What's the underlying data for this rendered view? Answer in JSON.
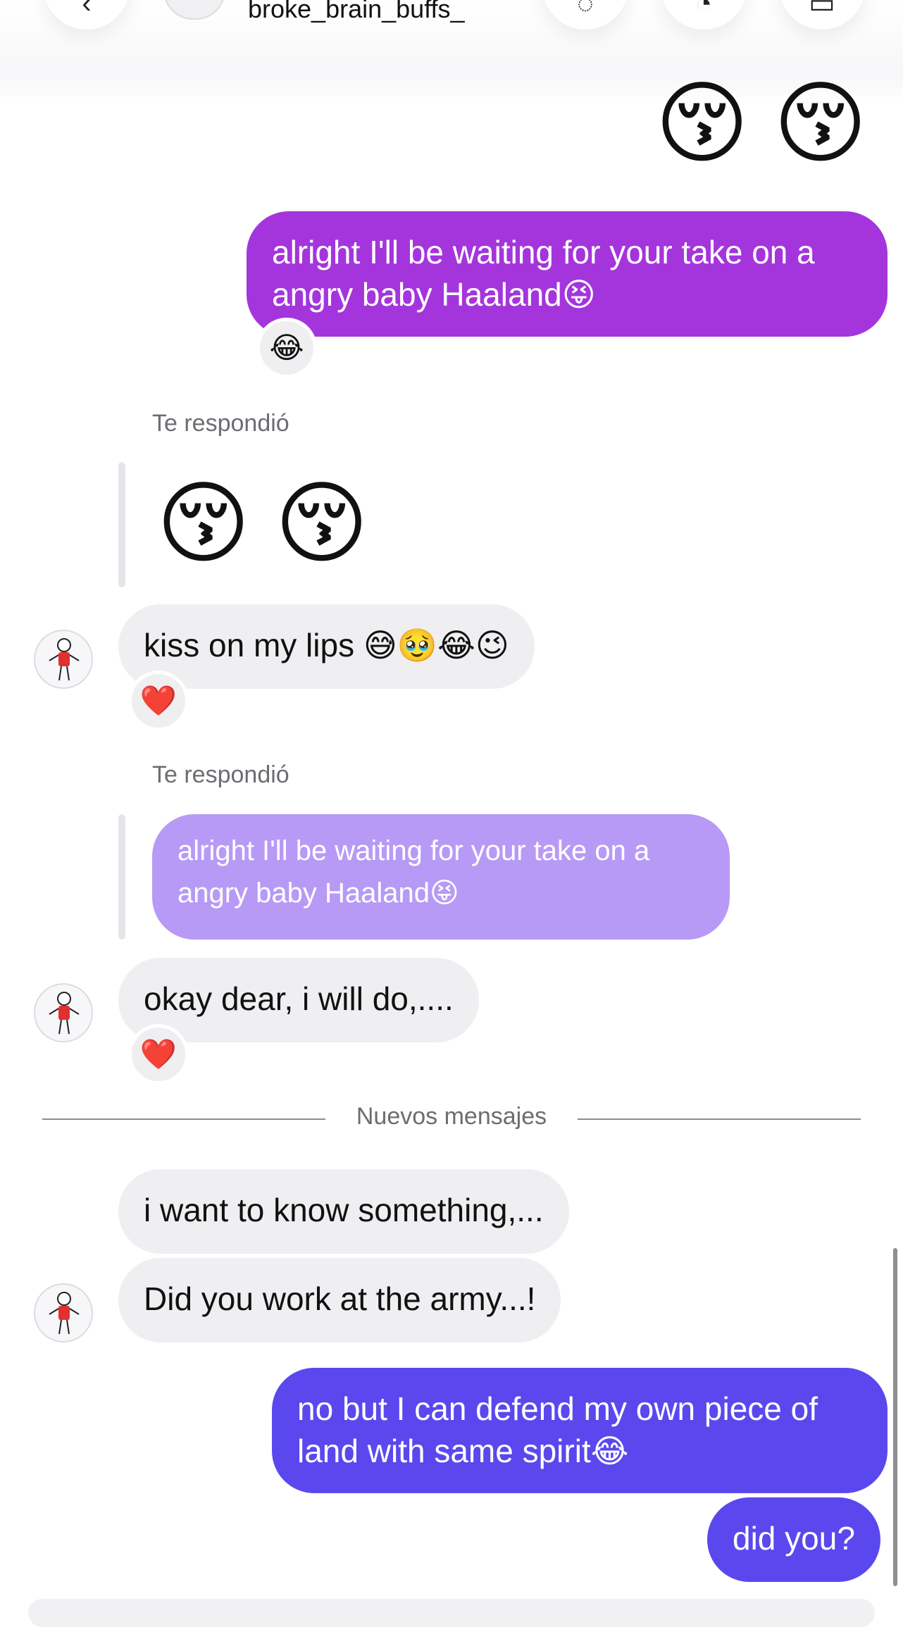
{
  "header": {
    "username": "broke_brain_buffs_",
    "icons": [
      "back-icon",
      "phone-icon",
      "video-icon",
      "info-icon"
    ]
  },
  "messages": {
    "top_emojis": [
      "😚",
      "😚"
    ],
    "out1_text": "alright I'll be waiting for your take on a angry baby Haaland😝",
    "out1_reaction": "😂",
    "reply_label_1": "Te respondió",
    "quoted_emojis": [
      "😚",
      "😚"
    ],
    "in1_text": "kiss on my lips 😅🥹😂😉",
    "in1_reaction": "❤️",
    "reply_label_2": "Te respondió",
    "quoted_text": "alright I'll be waiting for your take on a angry baby Haaland😝",
    "in2_text": "okay dear, i will do,....",
    "in2_reaction": "❤️",
    "new_messages_label": "Nuevos mensajes",
    "in3_text": "i want to know something,...",
    "in4_text": "Did you work at the army...!",
    "out2_text": "no but I can defend my own piece of land with same spirit😂",
    "out3_text": "did you?"
  },
  "colors": {
    "outgoing_purple": "#a435dc",
    "outgoing_blue": "#5a48ee",
    "incoming_gray": "#efeff2",
    "quoted_lavender": "#b79af5"
  }
}
